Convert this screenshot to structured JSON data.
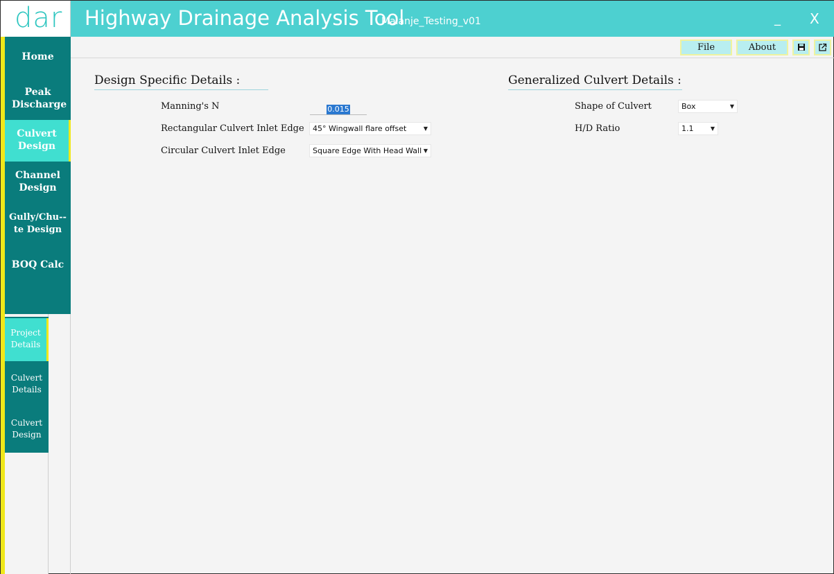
{
  "app": {
    "logo_text": "dar",
    "title": "Highway Drainage Analysis Tool",
    "project_name": "Malanje_Testing_v01",
    "minimize_label": "_",
    "close_label": "X"
  },
  "main_nav": {
    "items": [
      {
        "label": "Home",
        "active": false
      },
      {
        "label": "Peak Discharge",
        "active": false
      },
      {
        "label": "Culvert Design",
        "active": true
      },
      {
        "label": "Channel Design",
        "active": false
      },
      {
        "label": "Gully/Chu--te Design",
        "active": false
      },
      {
        "label": "BOQ Calc",
        "active": false
      }
    ]
  },
  "sub_nav": {
    "items": [
      {
        "label": "Project Details",
        "active": true
      },
      {
        "label": "Culvert Details",
        "active": false
      },
      {
        "label": "Culvert Design",
        "active": false
      }
    ]
  },
  "toolbar": {
    "file_label": "File",
    "about_label": "About",
    "save_icon": "save-icon",
    "export_icon": "external-link-icon"
  },
  "design_specific": {
    "title": "Design Specific Details :",
    "mannings_label": "Manning's N",
    "mannings_value": "0.015",
    "rect_inlet_label": "Rectangular Culvert Inlet Edge",
    "rect_inlet_value": "45° Wingwall flare offset",
    "circ_inlet_label": "Circular Culvert Inlet Edge",
    "circ_inlet_value": "Square Edge With Head Wall"
  },
  "generalized": {
    "title": "Generalized Culvert Details :",
    "shape_label": "Shape of Culvert",
    "shape_value": "Box",
    "hd_label": "H/D Ratio",
    "hd_value": "1.1"
  },
  "colors": {
    "accent": "#4dd0d0",
    "nav_bg": "#0a7c7c",
    "nav_active": "#40dfd0",
    "highlight": "#f0e81a"
  }
}
